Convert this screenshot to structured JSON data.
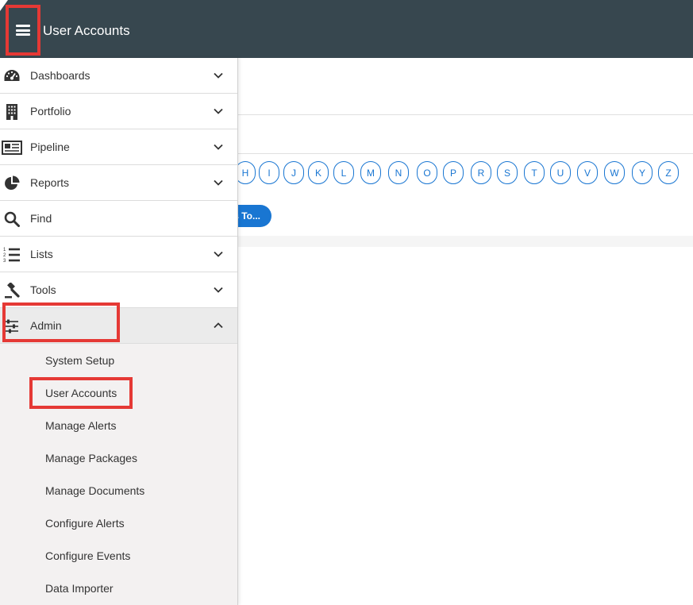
{
  "header": {
    "title": "User Accounts",
    "menu_icon": "hamburger-menu-icon",
    "background": "#37474f"
  },
  "content": {
    "letters": [
      "H",
      "I",
      "J",
      "K",
      "L",
      "M",
      "N",
      "O",
      "P",
      "R",
      "S",
      "T",
      "U",
      "V",
      "W",
      "Y",
      "Z"
    ],
    "goto_label": "s To..."
  },
  "sidebar": {
    "items": [
      {
        "label": "Dashboards",
        "icon": "dashboard-gauge-icon"
      },
      {
        "label": "Portfolio",
        "icon": "building-icon"
      },
      {
        "label": "Pipeline",
        "icon": "newspaper-icon"
      },
      {
        "label": "Reports",
        "icon": "pie-chart-icon"
      },
      {
        "label": "Find",
        "icon": "search-icon"
      },
      {
        "label": "Lists",
        "icon": "numbered-list-icon"
      },
      {
        "label": "Tools",
        "icon": "gavel-icon"
      },
      {
        "label": "Admin",
        "icon": "sliders-icon"
      }
    ],
    "submenu": [
      "System Setup",
      "User Accounts",
      "Manage Alerts",
      "Manage Packages",
      "Manage Documents",
      "Configure Alerts",
      "Configure Events",
      "Data Importer"
    ]
  },
  "colors": {
    "accent": "#1976d2",
    "highlight": "#e53935",
    "submenu_bg": "#f3f1f1"
  }
}
